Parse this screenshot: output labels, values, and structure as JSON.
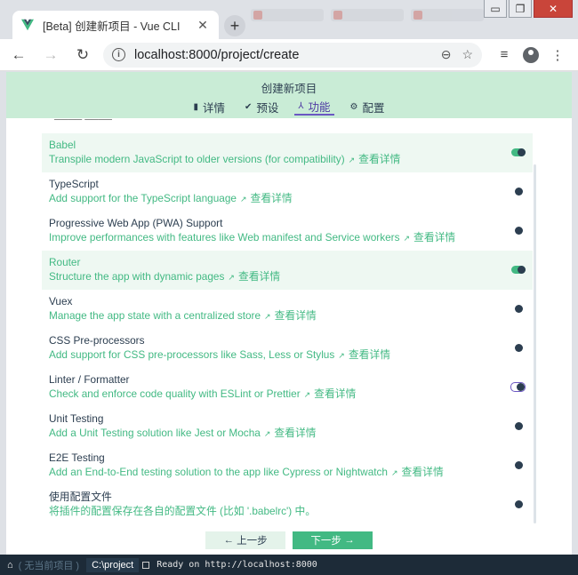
{
  "browser": {
    "tab_title": "[Beta] 创建新项目 - Vue CLI",
    "new_tab": "+",
    "url": "localhost:8000/project/create",
    "window_controls": {
      "minimize": "▭",
      "restore": "❐",
      "close": "✕"
    },
    "icons": [
      "vue-logo-icon",
      "back-arrow-icon",
      "forward-arrow-icon",
      "reload-icon",
      "info-icon",
      "zoom-icon",
      "star-icon",
      "playlist-icon",
      "account-icon",
      "menu-icon"
    ]
  },
  "header": {
    "title": "创建新项目",
    "steps": [
      {
        "label": "详情",
        "icon": "▮",
        "active": false
      },
      {
        "label": "预设",
        "icon": "✔",
        "active": false
      },
      {
        "label": "功能",
        "icon": "⅄",
        "active": true
      },
      {
        "label": "配置",
        "icon": "⚙",
        "active": false
      }
    ]
  },
  "features": {
    "more_label": "查看详情",
    "items": [
      {
        "name": "Babel",
        "desc": "Transpile modern JavaScript to older versions (for compatibility)",
        "enabled": true
      },
      {
        "name": "TypeScript",
        "desc": "Add support for the TypeScript language",
        "enabled": false
      },
      {
        "name": "Progressive Web App (PWA) Support",
        "desc": "Improve performances with features like Web manifest and Service workers",
        "enabled": false
      },
      {
        "name": "Router",
        "desc": "Structure the app with dynamic pages",
        "enabled": true
      },
      {
        "name": "Vuex",
        "desc": "Manage the app state with a centralized store",
        "enabled": false
      },
      {
        "name": "CSS Pre-processors",
        "desc": "Add support for CSS pre-processors like Sass, Less or Stylus",
        "enabled": false
      },
      {
        "name": "Linter / Formatter",
        "desc": "Check and enforce code quality with ESLint or Prettier",
        "enabled": false,
        "focused": true
      },
      {
        "name": "Unit Testing",
        "desc": "Add a Unit Testing solution like Jest or Mocha",
        "enabled": false
      },
      {
        "name": "E2E Testing",
        "desc": "Add an End-to-End testing solution to the app like Cypress or Nightwatch",
        "enabled": false
      },
      {
        "name": "使用配置文件",
        "desc": "将插件的配置保存在各自的配置文件 (比如 '.babelrc') 中。",
        "enabled": false,
        "no_link": true
      }
    ]
  },
  "footer": {
    "prev_label": "上一步",
    "next_label": "下一步",
    "prev_arrow": "←",
    "next_arrow": "→"
  },
  "statusbar": {
    "home": "⌂",
    "no_project": "( 无当前项目 )",
    "path": "C:\\project",
    "status": "Ready on http://localhost:8000"
  },
  "colors": {
    "accent": "#42b983",
    "header_bg": "#c9ecd6",
    "active_step": "#4f3aa3",
    "text": "#2c3e50"
  }
}
